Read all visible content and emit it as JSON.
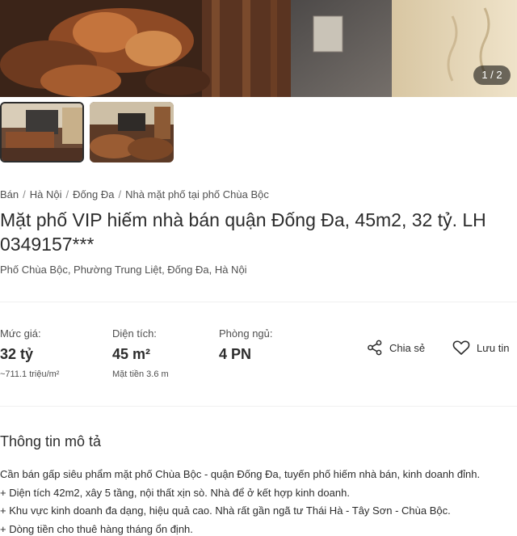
{
  "gallery": {
    "counter": "1 / 2"
  },
  "breadcrumb": [
    "Bán",
    "Hà Nội",
    "Đống Đa",
    "Nhà mặt phố tại phố Chùa Bộc"
  ],
  "listing": {
    "title": "Mặt phố VIP hiếm nhà bán quận Đống Đa, 45m2, 32 tỷ. LH 0349157***",
    "address": "Phố Chùa Bộc, Phường Trung Liệt, Đống Đa, Hà Nội"
  },
  "stats": {
    "price": {
      "label": "Mức giá:",
      "value": "32 tỷ",
      "sub": "~711.1 triệu/m²"
    },
    "area": {
      "label": "Diện tích:",
      "value": "45 m²",
      "sub": "Mặt tiền 3.6 m"
    },
    "bedrooms": {
      "label": "Phòng ngủ:",
      "value": "4 PN"
    }
  },
  "actions": {
    "share": "Chia sẻ",
    "save": "Lưu tin",
    "share_icon": "share-icon",
    "save_icon": "heart-icon"
  },
  "description": {
    "heading": "Thông tin mô tả",
    "lines": [
      "Cần bán gấp siêu phẩm mặt phố Chùa Bộc - quận Đống Đa, tuyến phố hiếm nhà bán, kinh doanh đỉnh.",
      "+ Diện tích 42m2, xây 5 tầng, nội thất xịn sò. Nhà để ở kết hợp kinh doanh.",
      "+ Khu vực kinh doanh đa dạng, hiệu quả cao. Nhà rất gần ngã tư Thái Hà - Tây Sơn - Chùa Bộc.",
      "+ Dòng tiền cho thuê hàng tháng ổn định."
    ]
  }
}
